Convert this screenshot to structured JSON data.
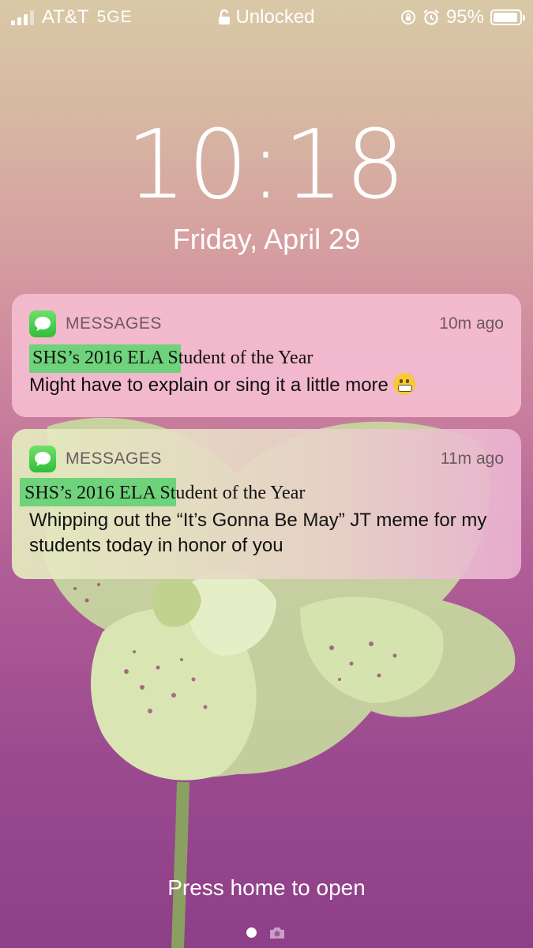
{
  "status_bar": {
    "carrier": "AT&T",
    "network": "5GE",
    "lock_status": "Unlocked",
    "battery_percent": "95%",
    "battery_level": 0.95,
    "signal_bars": 3,
    "signal_bars_total": 4
  },
  "lock_screen": {
    "time": "10:18",
    "date": "Friday, April 29",
    "footer": "Press home to open"
  },
  "notifications": [
    {
      "app": "MESSAGES",
      "time_ago": "10m ago",
      "title": "SHS’s 2016 ELA Student of the Year",
      "body": "Might have to explain or sing it a little more",
      "emoji": "grimacing-face"
    },
    {
      "app": "MESSAGES",
      "time_ago": "11m ago",
      "title": "SHS’s 2016 ELA Student of the Year",
      "body": "Whipping out the “It’s Gonna Be May” JT meme for my students today in honor of you"
    }
  ],
  "colors": {
    "messages_green": "#34c759",
    "highlight_green": "#6ed37a",
    "background_top": "#d8c9a6",
    "background_bottom": "#8d3f88"
  }
}
